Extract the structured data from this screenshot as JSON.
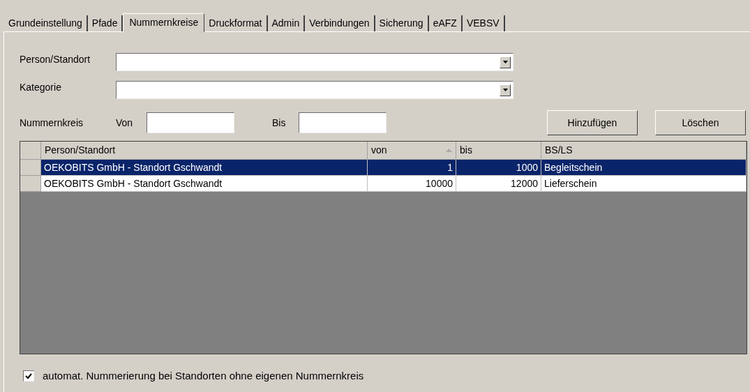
{
  "tabs": [
    {
      "label": "Grundeinstellung",
      "selected": false
    },
    {
      "label": "Pfade",
      "selected": false
    },
    {
      "label": "Nummernkreise",
      "selected": true
    },
    {
      "label": "Druckformat",
      "selected": false
    },
    {
      "label": "Admin",
      "selected": false
    },
    {
      "label": "Verbindungen",
      "selected": false
    },
    {
      "label": "Sicherung",
      "selected": false
    },
    {
      "label": "eAFZ",
      "selected": false
    },
    {
      "label": "VEBSV",
      "selected": false
    }
  ],
  "person_standort": {
    "label": "Person/Standort"
  },
  "kategorie": {
    "label": "Kategorie"
  },
  "nummernkreis": {
    "label": "Nummernkreis",
    "von_label": "Von",
    "bis_label": "Bis"
  },
  "buttons": [
    "Hinzufügen",
    "Löschen"
  ],
  "table": {
    "columns": [
      "Person/Standort",
      "von",
      "bis",
      "BS/LS"
    ],
    "rows": [
      {
        "cells": [
          "OEKOBITS GmbH - Standort Gschwandt",
          "1",
          "1000",
          "Begleitschein"
        ],
        "selected": true
      },
      {
        "cells": [
          "OEKOBITS GmbH - Standort Gschwandt",
          "10000",
          "12000",
          "Lieferschein"
        ],
        "selected": false
      }
    ]
  },
  "auto_numbering": {
    "label": "automat. Nummerierung bei Standorten ohne eigenen Nummernkreis",
    "checked": true
  }
}
